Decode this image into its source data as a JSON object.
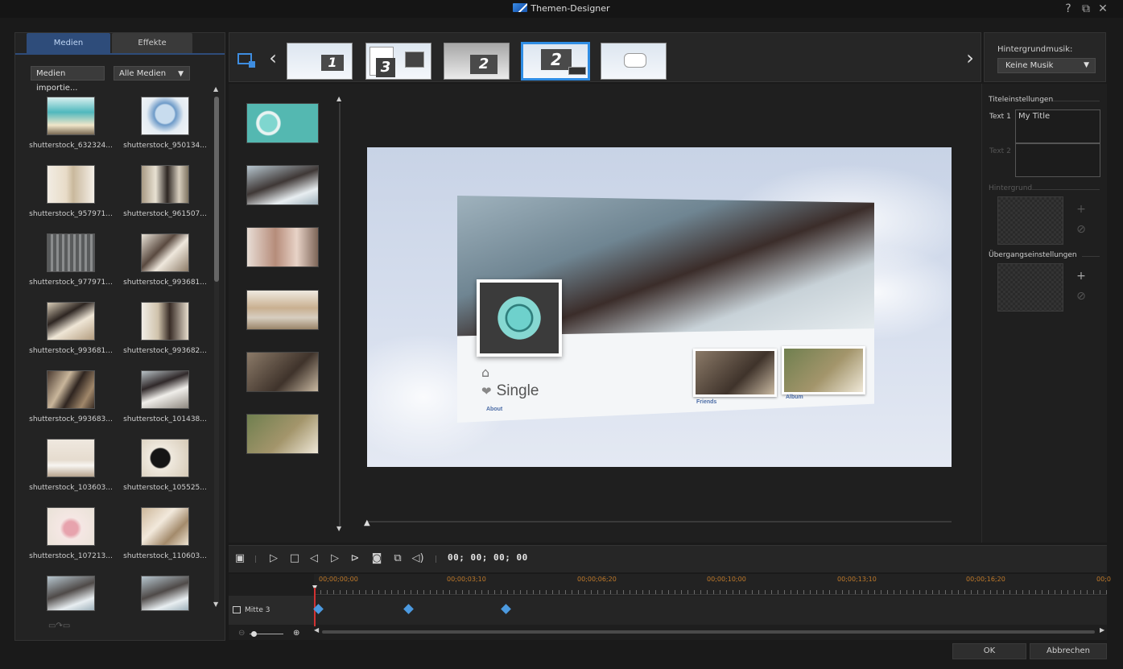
{
  "window": {
    "title": "Themen-Designer",
    "help": "?",
    "restore": "⧉",
    "close": "✕"
  },
  "left_panel": {
    "tabs": [
      "Medien",
      "Effekte"
    ],
    "import_label": "Medien importie...",
    "filter_label": "Alle Medien",
    "media": [
      "shutterstock_632324...",
      "shutterstock_950134...",
      "shutterstock_957971...",
      "shutterstock_961507...",
      "shutterstock_977971...",
      "shutterstock_993681...",
      "shutterstock_993681...",
      "shutterstock_993682...",
      "shutterstock_993683...",
      "shutterstock_101438...",
      "shutterstock_103603...",
      "shutterstock_105525...",
      "shutterstock_107213...",
      "shutterstock_110603...",
      "",
      ""
    ]
  },
  "template_strip": {
    "templates": [
      "1",
      "3",
      "2",
      "2",
      ""
    ],
    "selected_index": 3
  },
  "music": {
    "label": "Hintergrundmusik:",
    "value": "Keine Musik"
  },
  "preview": {
    "card_title": "Single",
    "about_label": "About",
    "friends_label": "Friends",
    "album_label": "Album"
  },
  "right_panel": {
    "title_settings": "Titeleinstellungen",
    "text1_label": "Text 1",
    "text1_value": "My Title",
    "text2_label": "Text 2",
    "text2_value": "",
    "background_label": "Hintergrund",
    "transition_label": "Übergangseinstellungen"
  },
  "playback": {
    "timecode": "00; 00; 00; 00"
  },
  "timeline": {
    "ruler": [
      "00;00;00;00",
      "00;00;03;10",
      "00;00;06;20",
      "00;00;10;00",
      "00;00;13;10",
      "00;00;16;20",
      "00;0"
    ],
    "track_name": "Mitte 3"
  },
  "buttons": {
    "ok": "OK",
    "cancel": "Abbrechen"
  },
  "colors": {
    "accent": "#2f8de4",
    "tab_active": "#2e4c7a",
    "ruler_text": "#c07a2a",
    "playhead": "#d23232",
    "keyframe": "#4c9ae0"
  }
}
